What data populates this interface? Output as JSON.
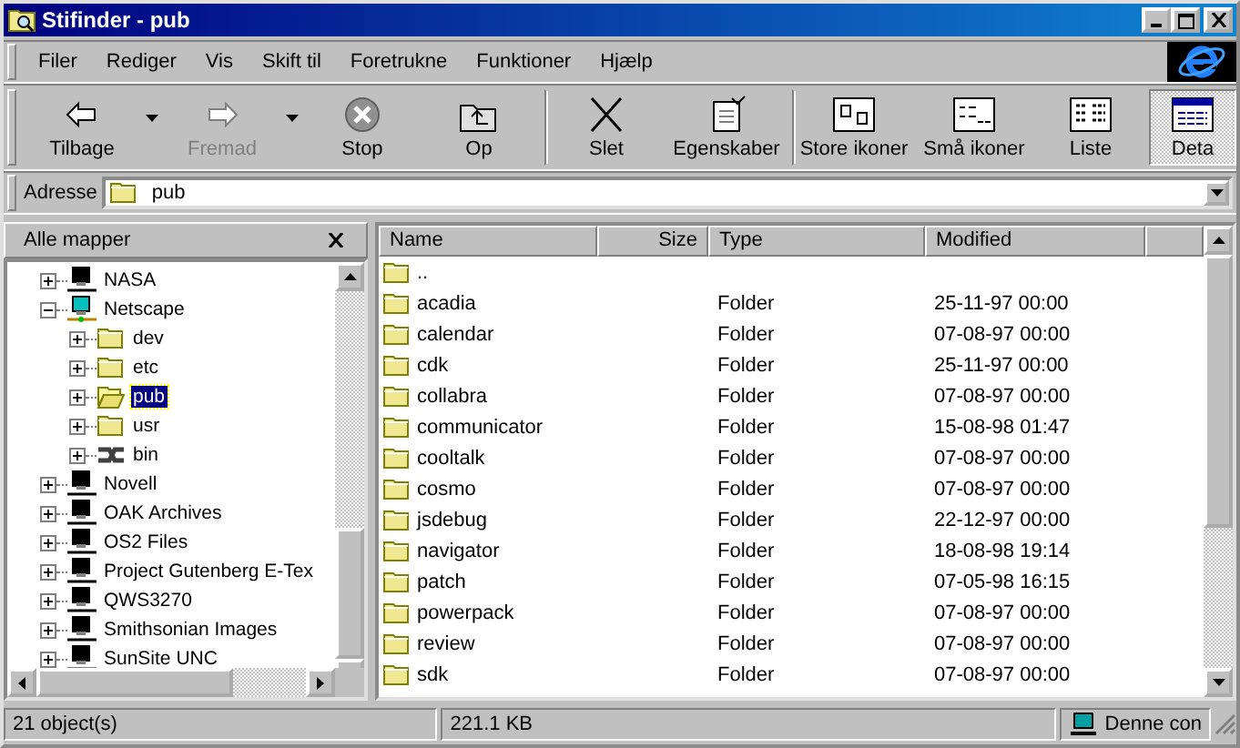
{
  "window": {
    "title": "Stifinder - pub"
  },
  "menu": [
    "Filer",
    "Rediger",
    "Vis",
    "Skift til",
    "Foretrukne",
    "Funktioner",
    "Hjælp"
  ],
  "toolbar": [
    {
      "label": "Tilbage",
      "kind": "back",
      "disabled": false,
      "dropdown": true,
      "selected": false
    },
    {
      "label": "Fremad",
      "kind": "forward",
      "disabled": true,
      "dropdown": true,
      "selected": false
    },
    {
      "label": "Stop",
      "kind": "stop",
      "disabled": false,
      "dropdown": false,
      "selected": false
    },
    {
      "label": "Op",
      "kind": "up",
      "disabled": false,
      "dropdown": false,
      "selected": false
    },
    {
      "label": "Slet",
      "kind": "delete",
      "disabled": false,
      "dropdown": false,
      "selected": false,
      "separator_before": true
    },
    {
      "label": "Egenskaber",
      "kind": "properties",
      "disabled": false,
      "dropdown": false,
      "selected": false
    },
    {
      "label": "Store ikoner",
      "kind": "large",
      "disabled": false,
      "dropdown": false,
      "selected": false,
      "separator_before": true
    },
    {
      "label": "Små ikoner",
      "kind": "small",
      "disabled": false,
      "dropdown": false,
      "selected": false
    },
    {
      "label": "Liste",
      "kind": "list",
      "disabled": false,
      "dropdown": false,
      "selected": false
    },
    {
      "label": "Deta",
      "kind": "details",
      "disabled": false,
      "dropdown": false,
      "selected": true
    }
  ],
  "address": {
    "label": "Adresse",
    "value": "pub"
  },
  "tree": {
    "title": "Alle mapper",
    "items": [
      {
        "label": "NASA",
        "kind": "server",
        "expanded": false,
        "selected": false
      },
      {
        "label": "Netscape",
        "kind": "server-active",
        "expanded": true,
        "selected": false,
        "children": [
          {
            "label": "dev",
            "kind": "folder",
            "expanded": false,
            "selected": false
          },
          {
            "label": "etc",
            "kind": "folder",
            "expanded": false,
            "selected": false
          },
          {
            "label": "pub",
            "kind": "folder",
            "expanded": false,
            "selected": true
          },
          {
            "label": "usr",
            "kind": "folder",
            "expanded": false,
            "selected": false
          },
          {
            "label": "bin",
            "kind": "link",
            "expanded": false,
            "selected": false
          }
        ]
      },
      {
        "label": "Novell",
        "kind": "server",
        "expanded": false,
        "selected": false
      },
      {
        "label": "OAK Archives",
        "kind": "server",
        "expanded": false,
        "selected": false
      },
      {
        "label": "OS2 Files",
        "kind": "server",
        "expanded": false,
        "selected": false
      },
      {
        "label": "Project Gutenberg E-Tex",
        "kind": "server",
        "expanded": false,
        "selected": false
      },
      {
        "label": "QWS3270",
        "kind": "server",
        "expanded": false,
        "selected": false
      },
      {
        "label": "Smithsonian Images",
        "kind": "server",
        "expanded": false,
        "selected": false
      },
      {
        "label": "SunSite UNC",
        "kind": "server",
        "expanded": false,
        "selected": false
      }
    ]
  },
  "table": {
    "columns": [
      "Name",
      "Size",
      "Type",
      "Modified"
    ],
    "rows": [
      {
        "name": ".."
      },
      {
        "name": "acadia",
        "type": "Folder",
        "modified": "25-11-97 00:00"
      },
      {
        "name": "calendar",
        "type": "Folder",
        "modified": "07-08-97 00:00"
      },
      {
        "name": "cdk",
        "type": "Folder",
        "modified": "25-11-97 00:00"
      },
      {
        "name": "collabra",
        "type": "Folder",
        "modified": "07-08-97 00:00"
      },
      {
        "name": "communicator",
        "type": "Folder",
        "modified": "15-08-98 01:47"
      },
      {
        "name": "cooltalk",
        "type": "Folder",
        "modified": "07-08-97 00:00"
      },
      {
        "name": "cosmo",
        "type": "Folder",
        "modified": "07-08-97 00:00"
      },
      {
        "name": "jsdebug",
        "type": "Folder",
        "modified": "22-12-97 00:00"
      },
      {
        "name": "navigator",
        "type": "Folder",
        "modified": "18-08-98 19:14"
      },
      {
        "name": "patch",
        "type": "Folder",
        "modified": "07-05-98 16:15"
      },
      {
        "name": "powerpack",
        "type": "Folder",
        "modified": "07-08-97 00:00"
      },
      {
        "name": "review",
        "type": "Folder",
        "modified": "07-08-97 00:00"
      },
      {
        "name": "sdk",
        "type": "Folder",
        "modified": "07-08-97 00:00"
      }
    ]
  },
  "status_bar": {
    "objects": "21 object(s)",
    "size": "221.1 KB",
    "zone": "Denne con"
  }
}
